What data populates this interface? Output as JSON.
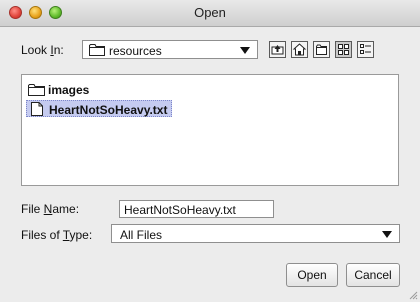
{
  "window": {
    "title": "Open"
  },
  "look_in": {
    "label_pre": "Look ",
    "label_mnemonic": "I",
    "label_post": "n:",
    "value": "resources"
  },
  "toolbar": {
    "icons": [
      "up-folder",
      "home",
      "new-folder",
      "list-view",
      "details-view"
    ]
  },
  "files": [
    {
      "name": "images",
      "type": "folder",
      "selected": false
    },
    {
      "name": "HeartNotSoHeavy.txt",
      "type": "file",
      "selected": true
    }
  ],
  "file_name": {
    "label_pre": "File ",
    "label_mnemonic": "N",
    "label_post": "ame:",
    "value": "HeartNotSoHeavy.txt"
  },
  "files_of_type": {
    "label_pre": "Files of ",
    "label_mnemonic": "T",
    "label_post": "ype:",
    "value": "All Files"
  },
  "buttons": {
    "open": "Open",
    "cancel": "Cancel"
  }
}
